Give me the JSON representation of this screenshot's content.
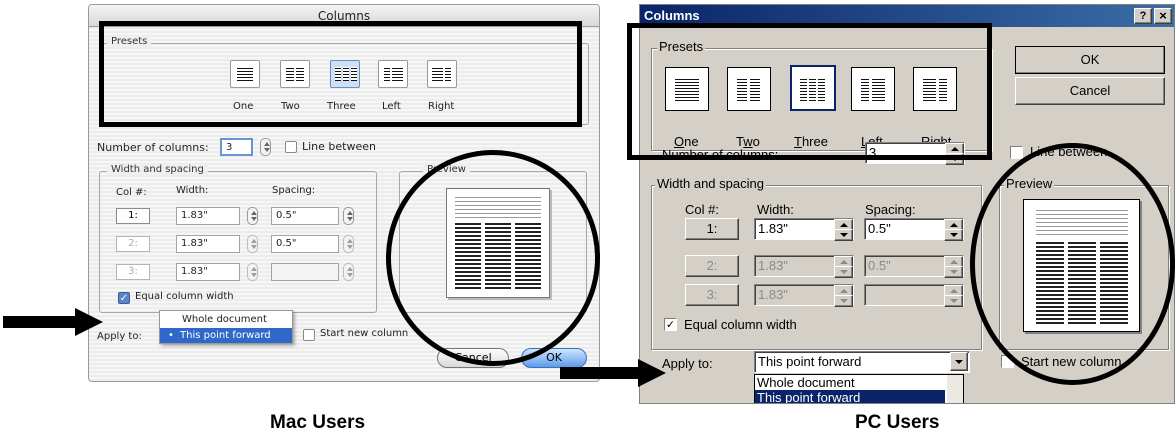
{
  "mac": {
    "title": "Columns",
    "presets_label": "Presets",
    "presets": [
      "One",
      "Two",
      "Three",
      "Left",
      "Right"
    ],
    "selected_preset": "Three",
    "num_columns_label": "Number of columns:",
    "num_columns_value": "3",
    "line_between_label": "Line between",
    "width_spacing_label": "Width and spacing",
    "col_header": "Col #:",
    "width_header": "Width:",
    "spacing_header": "Spacing:",
    "rows": [
      {
        "col": "1:",
        "width": "1.83\"",
        "spacing": "0.5\""
      },
      {
        "col": "2:",
        "width": "1.83\"",
        "spacing": "0.5\""
      },
      {
        "col": "3:",
        "width": "1.83\"",
        "spacing": ""
      }
    ],
    "equal_width_label": "Equal column width",
    "preview_label": "Preview",
    "apply_to_label": "Apply to:",
    "apply_options": [
      "Whole document",
      "This point forward"
    ],
    "apply_selected": "This point forward",
    "start_new_column_label": "Start new column",
    "cancel_label": "Cancel",
    "ok_label": "OK"
  },
  "pc": {
    "title": "Columns",
    "help_btn": "?",
    "close_btn": "×",
    "presets_label": "Presets",
    "presets": [
      "One",
      "Two",
      "Three",
      "Left",
      "Right"
    ],
    "preset_accel": [
      "O",
      "w",
      "T",
      "L",
      "R"
    ],
    "selected_preset": "Three",
    "ok_label": "OK",
    "cancel_label": "Cancel",
    "num_columns_label": "Number of columns:",
    "num_columns_value": "3",
    "line_between_label": "Line between",
    "width_spacing_label": "Width and spacing",
    "col_header": "Col #:",
    "width_header": "Width:",
    "spacing_header": "Spacing:",
    "rows": [
      {
        "col": "1:",
        "width": "1.83\"",
        "spacing": "0.5\""
      },
      {
        "col": "2:",
        "width": "1.83\"",
        "spacing": "0.5\""
      },
      {
        "col": "3:",
        "width": "1.83\"",
        "spacing": ""
      }
    ],
    "equal_width_label": "Equal column width",
    "preview_label": "Preview",
    "apply_to_label": "Apply to:",
    "apply_value": "This point forward",
    "apply_options": [
      "Whole document",
      "This point forward"
    ],
    "start_new_column_label": "Start new column"
  },
  "captions": {
    "mac": "Mac Users",
    "pc": "PC Users"
  },
  "colors": {
    "pc_title_bar": "#0a246a",
    "pc_selection": "#0a246a",
    "mac_selection": "#2f68c8",
    "annotation": "#000000"
  }
}
